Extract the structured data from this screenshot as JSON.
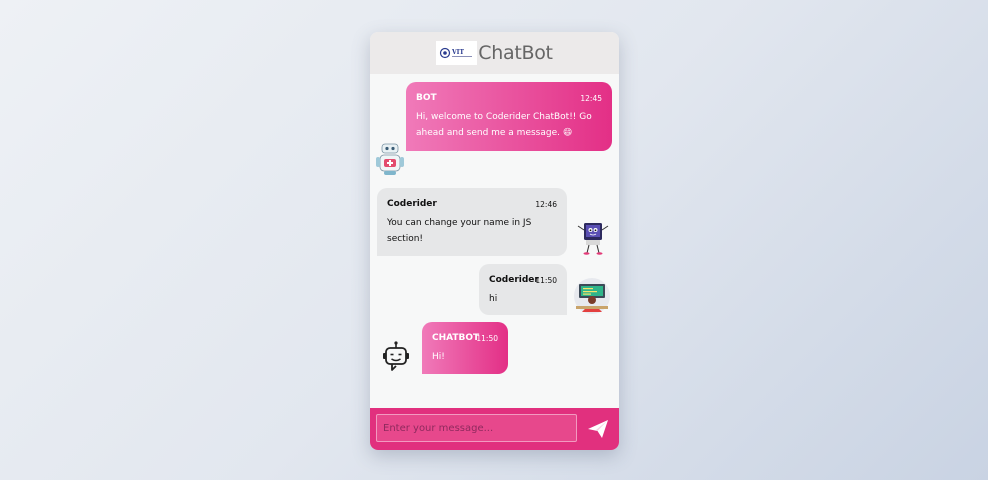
{
  "app": {
    "title": "ChatBot",
    "logo_text": "VIT"
  },
  "colors": {
    "accent": "#e1307e",
    "bubble_pink_start": "#f07ab9",
    "bubble_pink_end": "#e32f86",
    "bubble_gray": "#e6e7e8",
    "header_bg": "#eceaea"
  },
  "messages": [
    {
      "sender": "BOT",
      "time": "12:45",
      "text": "Hi, welcome to Coderider ChatBot!! Go ahead and send me a message. 😄",
      "side": "left",
      "avatar": "robot-doctor-icon"
    },
    {
      "sender": "Coderider",
      "time": "12:46",
      "text": "You can change your name in JS section!",
      "side": "right",
      "avatar": "computer-character-icon"
    },
    {
      "sender": "Coderider",
      "time": "11:50",
      "text": "hi",
      "side": "right",
      "avatar": "coder-at-desk-icon"
    },
    {
      "sender": "CHATBOT",
      "time": "11:50",
      "text": "Hi!",
      "side": "left",
      "avatar": "chatbot-head-icon"
    }
  ],
  "composer": {
    "placeholder": "Enter your message...",
    "value": "",
    "send_icon": "paper-plane-icon"
  }
}
